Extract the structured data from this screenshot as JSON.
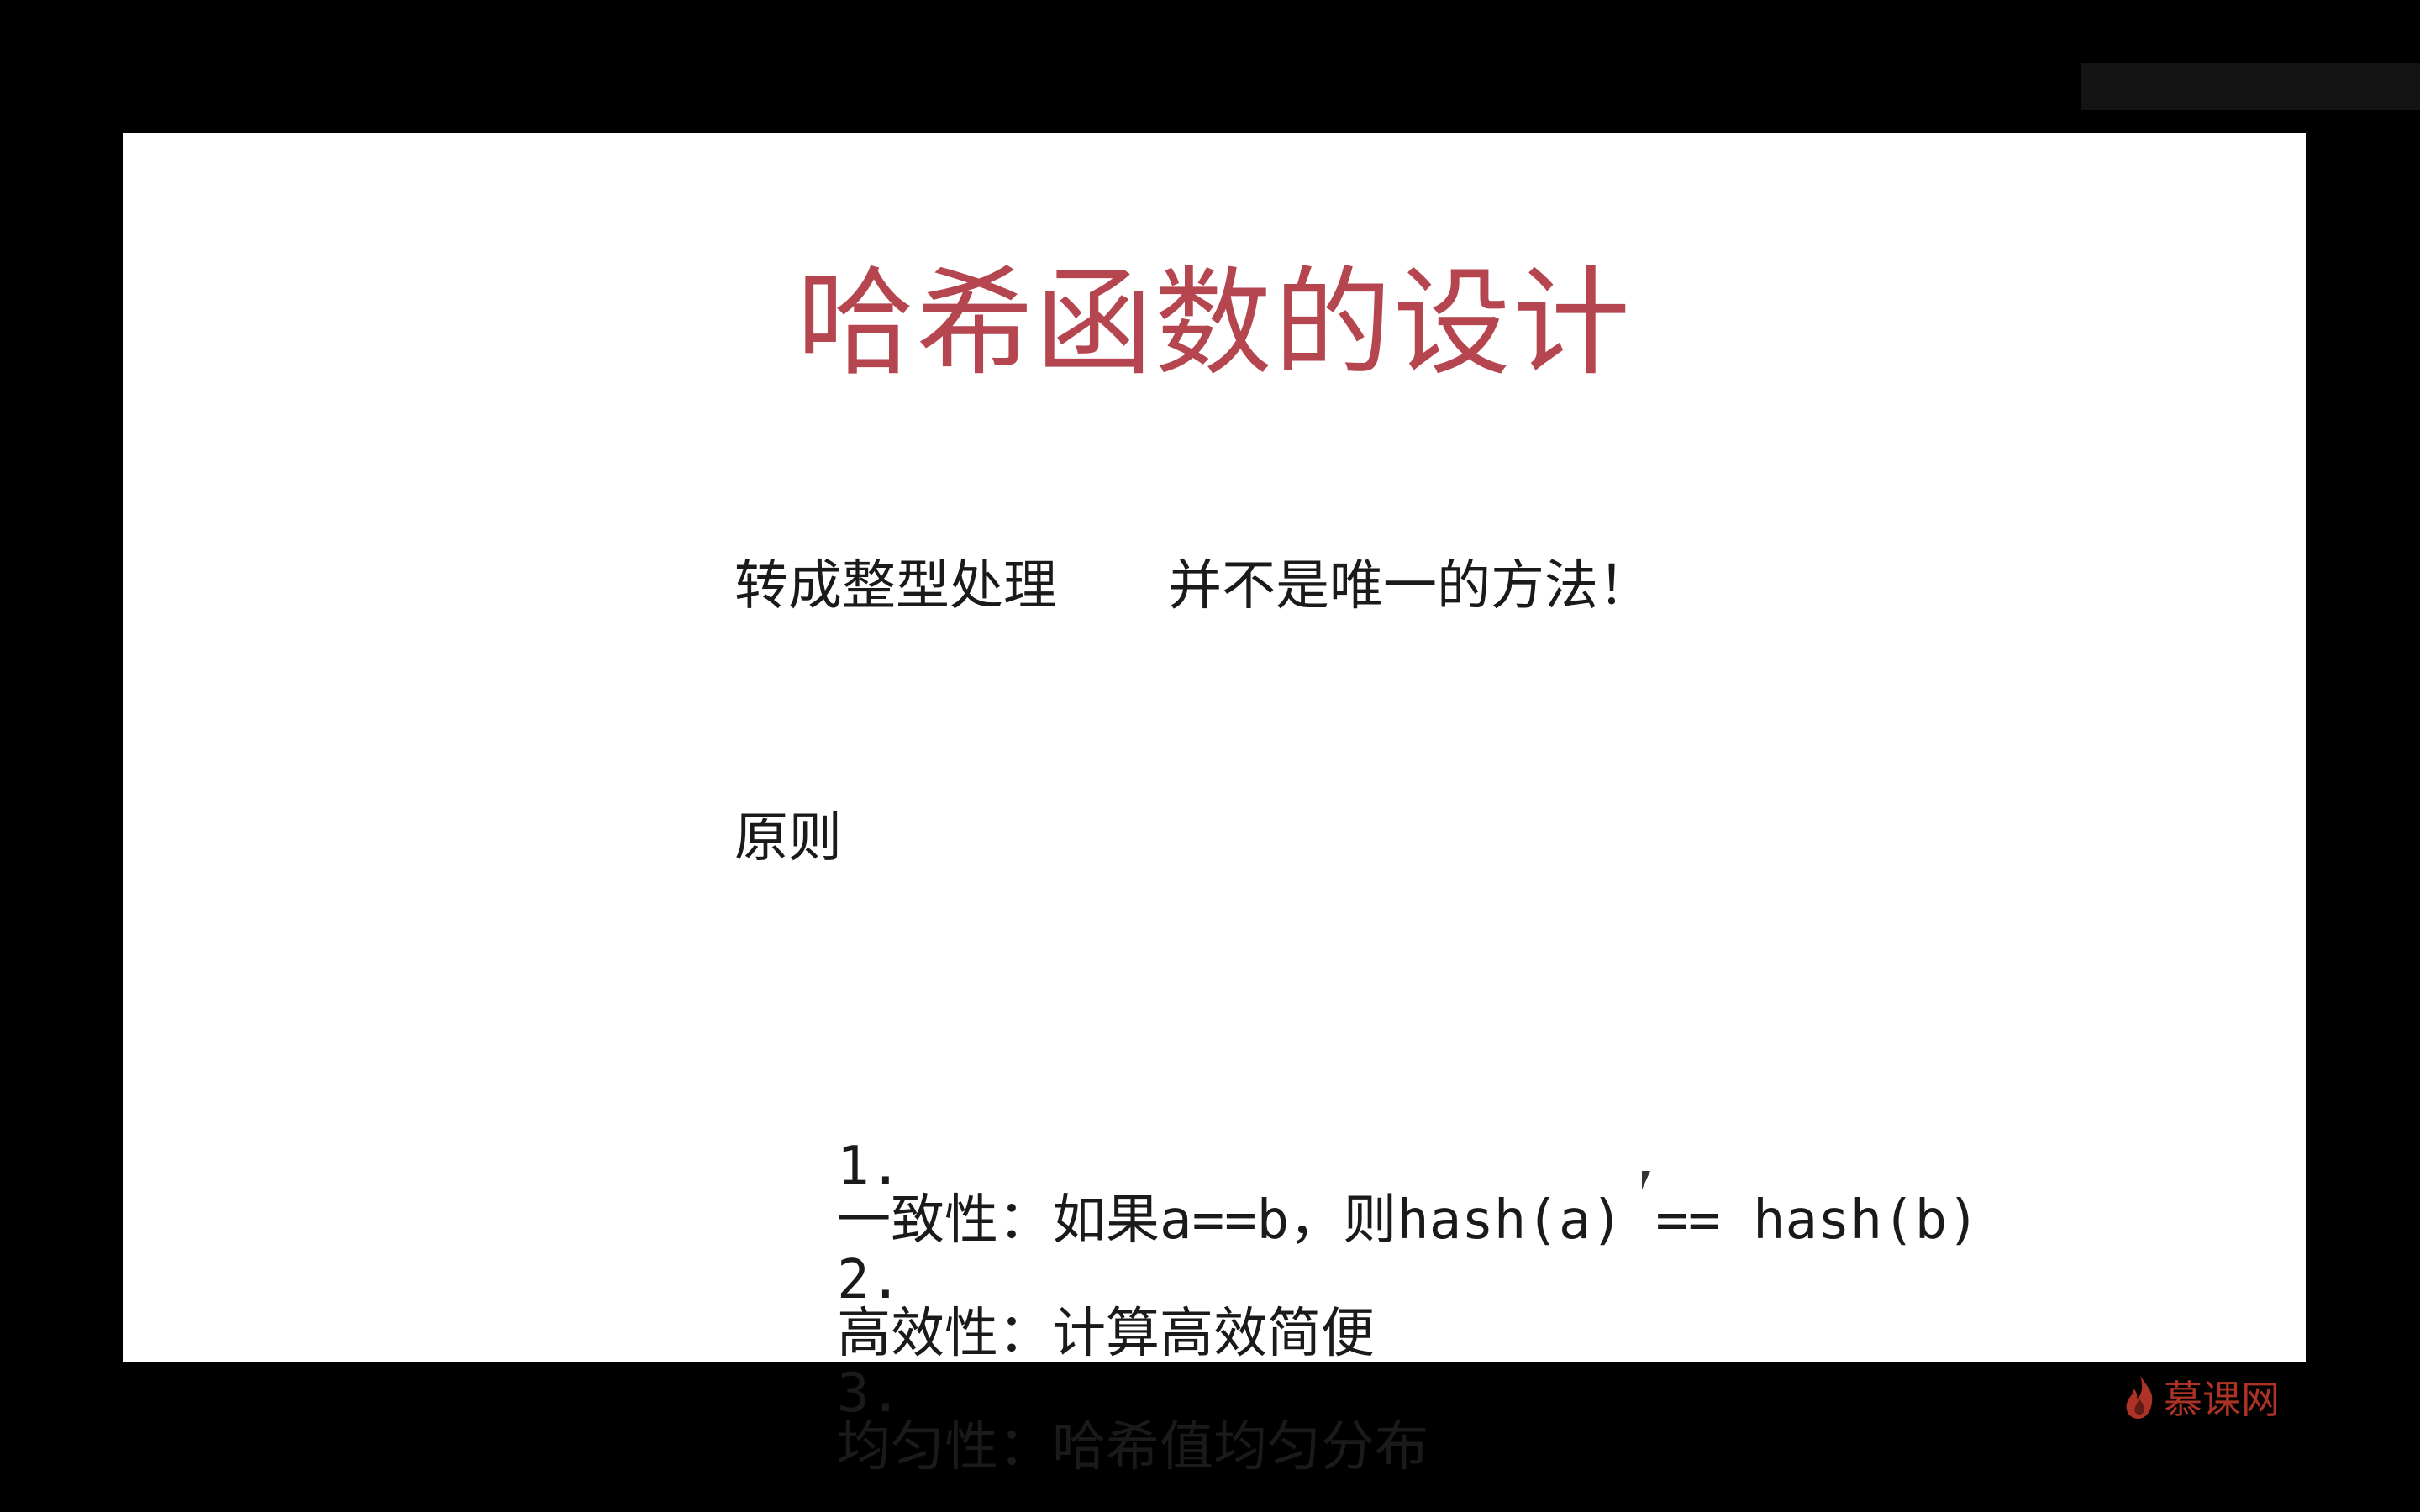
{
  "slide": {
    "title": "哈希函数的设计",
    "line_convert": "转成整型处理",
    "line_not_only": "并不是唯一的方法！",
    "heading": "原则",
    "items": [
      {
        "number": "1.",
        "label": "一致性：",
        "text": "如果a==b，则hash(a) == hash(b)"
      },
      {
        "number": "2.",
        "label": "高效性：",
        "text": "计算高效简便"
      },
      {
        "number": "3.",
        "label": "均匀性：",
        "text": "哈希值均匀分布"
      }
    ]
  },
  "watermark": {
    "brand": "慕课网",
    "icon": "flame-icon",
    "color": "#c0392b"
  },
  "colors": {
    "title": "#b5464f",
    "background": "#000000",
    "slide": "#ffffff"
  }
}
